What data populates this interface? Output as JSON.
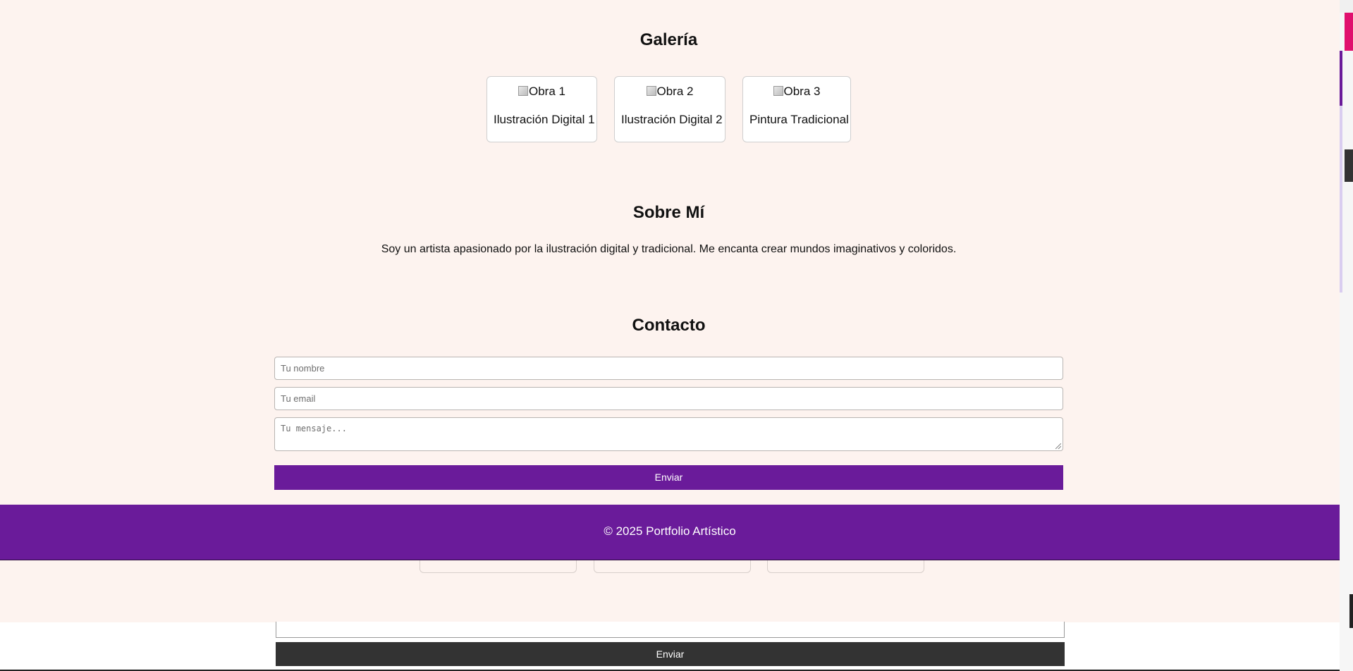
{
  "gallery": {
    "title": "Galería",
    "items": [
      {
        "alt": "Obra 1",
        "caption": "Ilustración Digital 1"
      },
      {
        "alt": "Obra 2",
        "caption": "Ilustración Digital 2"
      },
      {
        "alt": "Obra 3",
        "caption": "Pintura Tradicional"
      }
    ]
  },
  "about": {
    "title": "Sobre Mí",
    "text": "Soy un artista apasionado por la ilustración digital y tradicional. Me encanta crear mundos imaginativos y coloridos."
  },
  "contact": {
    "title": "Contacto",
    "name_placeholder": "Tu nombre",
    "email_placeholder": "Tu email",
    "message_placeholder": "Tu mensaje...",
    "send_label": "Enviar"
  },
  "footer": {
    "text": "© 2025 Portfolio Artístico"
  },
  "ghost": {
    "send_label": "Enviar"
  },
  "colors": {
    "background": "#fdf3ef",
    "accent": "#6a1b9a",
    "ghost_button": "#333333"
  }
}
